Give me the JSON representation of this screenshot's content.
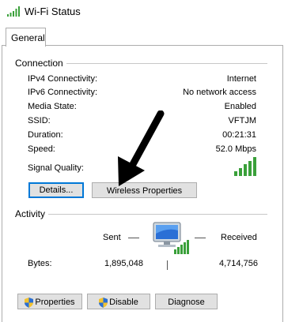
{
  "window": {
    "title": "Wi-Fi Status",
    "icon": "wifi-signal-icon"
  },
  "tabs": [
    {
      "label": "General",
      "active": true
    }
  ],
  "connection": {
    "group_label": "Connection",
    "rows": [
      {
        "label": "IPv4 Connectivity:",
        "value": "Internet"
      },
      {
        "label": "IPv6 Connectivity:",
        "value": "No network access"
      },
      {
        "label": "Media State:",
        "value": "Enabled"
      },
      {
        "label": "SSID:",
        "value": "VFTJM"
      },
      {
        "label": "Duration:",
        "value": "00:21:31"
      },
      {
        "label": "Speed:",
        "value": "52.0 Mbps"
      }
    ],
    "signal_quality_label": "Signal Quality:",
    "signal_bars_filled": 5,
    "details_button": "Details...",
    "wireless_properties_button": "Wireless Properties"
  },
  "activity": {
    "group_label": "Activity",
    "sent_label": "Sent",
    "received_label": "Received",
    "bytes_label": "Bytes:",
    "bytes_sent": "1,895,048",
    "bytes_received": "4,714,756"
  },
  "buttons": {
    "properties": "Properties",
    "disable": "Disable",
    "diagnose": "Diagnose"
  },
  "colors": {
    "accent": "#0078d7",
    "signal_green": "#3aa03a"
  }
}
